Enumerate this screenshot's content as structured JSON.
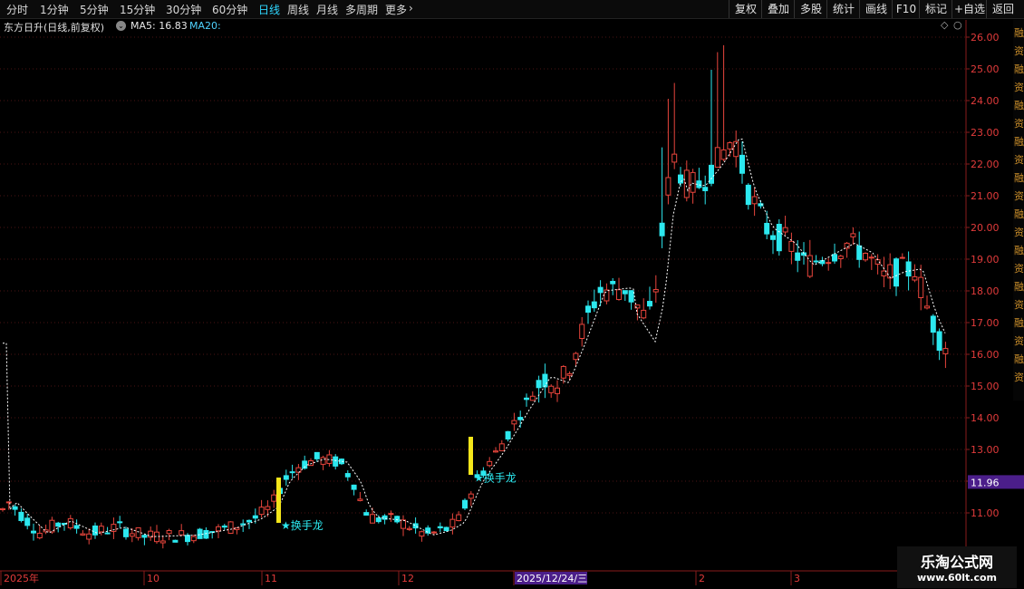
{
  "toolbar": {
    "periods": [
      "分时",
      "1分钟",
      "5分钟",
      "15分钟",
      "30分钟",
      "60分钟",
      "日线",
      "周线",
      "月线",
      "多周期",
      "更多"
    ],
    "active_period": "日线",
    "right_buttons": [
      "复权",
      "叠加",
      "多股",
      "统计",
      "画线",
      "F10",
      "标记",
      "+自选",
      "返回"
    ]
  },
  "info": {
    "title": "东方日升(日线,前复权)",
    "ma5": "MA5: 16.83",
    "ma20": "MA20:"
  },
  "colors": {
    "up": "#e8453c",
    "down": "#2ce8ef",
    "ma": "#ffffff",
    "marker": "#f4e61a",
    "price_tag": "#4b1e8a"
  },
  "watermark": {
    "line1": "乐淘公式网",
    "line2": "www.60lt.com"
  },
  "chart_data": {
    "type": "candlestick",
    "ylim": [
      10.0,
      26.5
    ],
    "y_ticks": [
      "11.00",
      "12.00",
      "13.00",
      "14.00",
      "15.00",
      "16.00",
      "17.00",
      "18.00",
      "19.00",
      "20.00",
      "21.00",
      "22.00",
      "23.00",
      "24.00",
      "25.00",
      "26.00"
    ],
    "current_price_label": "11.96",
    "x_labels": [
      "2025年",
      "10",
      "11",
      "12",
      "2025/12/24/三",
      "2",
      "3"
    ],
    "annotations": [
      {
        "text": "★换手龙",
        "price": 10.6
      },
      {
        "text": "★换手龙",
        "price": 12.1
      }
    ],
    "right_panel_glyphs": [
      "融",
      "资",
      "融",
      "资",
      "融",
      "资",
      "融",
      "资",
      "融",
      "资",
      "融",
      "资",
      "融",
      "资",
      "融",
      "资",
      "融",
      "资",
      "融",
      "资"
    ]
  }
}
